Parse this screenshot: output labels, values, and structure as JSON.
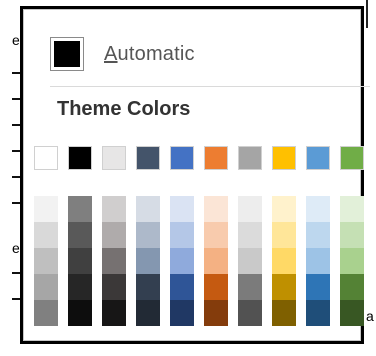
{
  "automatic": {
    "prefix": "A",
    "rest": "utomatic",
    "color": "#000000"
  },
  "theme_header": "Theme Colors",
  "background_chars": {
    "left_top": "e",
    "left_mid": "e",
    "right_bottom": "a"
  },
  "theme_colors": [
    {
      "name": "white",
      "base": "#ffffff",
      "shades": [
        "#f2f2f2",
        "#d9d9d9",
        "#bfbfbf",
        "#a6a6a6",
        "#808080"
      ]
    },
    {
      "name": "black",
      "base": "#000000",
      "shades": [
        "#7f7f7f",
        "#595959",
        "#404040",
        "#262626",
        "#0d0d0d"
      ]
    },
    {
      "name": "light-gray",
      "base": "#e7e6e6",
      "shades": [
        "#d0cece",
        "#afabab",
        "#767171",
        "#3b3838",
        "#171616"
      ]
    },
    {
      "name": "blue-gray",
      "base": "#44546a",
      "shades": [
        "#d6dce5",
        "#adb9ca",
        "#8497b0",
        "#333f50",
        "#222a35"
      ]
    },
    {
      "name": "blue",
      "base": "#4472c4",
      "shades": [
        "#dae3f3",
        "#b4c7e7",
        "#8faadc",
        "#2f5597",
        "#203864"
      ]
    },
    {
      "name": "orange",
      "base": "#ed7d31",
      "shades": [
        "#fbe5d6",
        "#f8cbad",
        "#f4b183",
        "#c55a11",
        "#843c0c"
      ]
    },
    {
      "name": "gray",
      "base": "#a5a5a5",
      "shades": [
        "#ededed",
        "#dbdbdb",
        "#c9c9c9",
        "#7b7b7b",
        "#525252"
      ]
    },
    {
      "name": "gold",
      "base": "#ffc000",
      "shades": [
        "#fff2cc",
        "#ffe699",
        "#ffd966",
        "#bf9000",
        "#7f6000"
      ]
    },
    {
      "name": "light-blue",
      "base": "#5b9bd5",
      "shades": [
        "#deebf7",
        "#bdd7ee",
        "#9dc3e6",
        "#2e75b6",
        "#1f4e79"
      ]
    },
    {
      "name": "green",
      "base": "#70ad47",
      "shades": [
        "#e2f0d9",
        "#c5e0b4",
        "#a9d18e",
        "#548235",
        "#385723"
      ]
    }
  ]
}
